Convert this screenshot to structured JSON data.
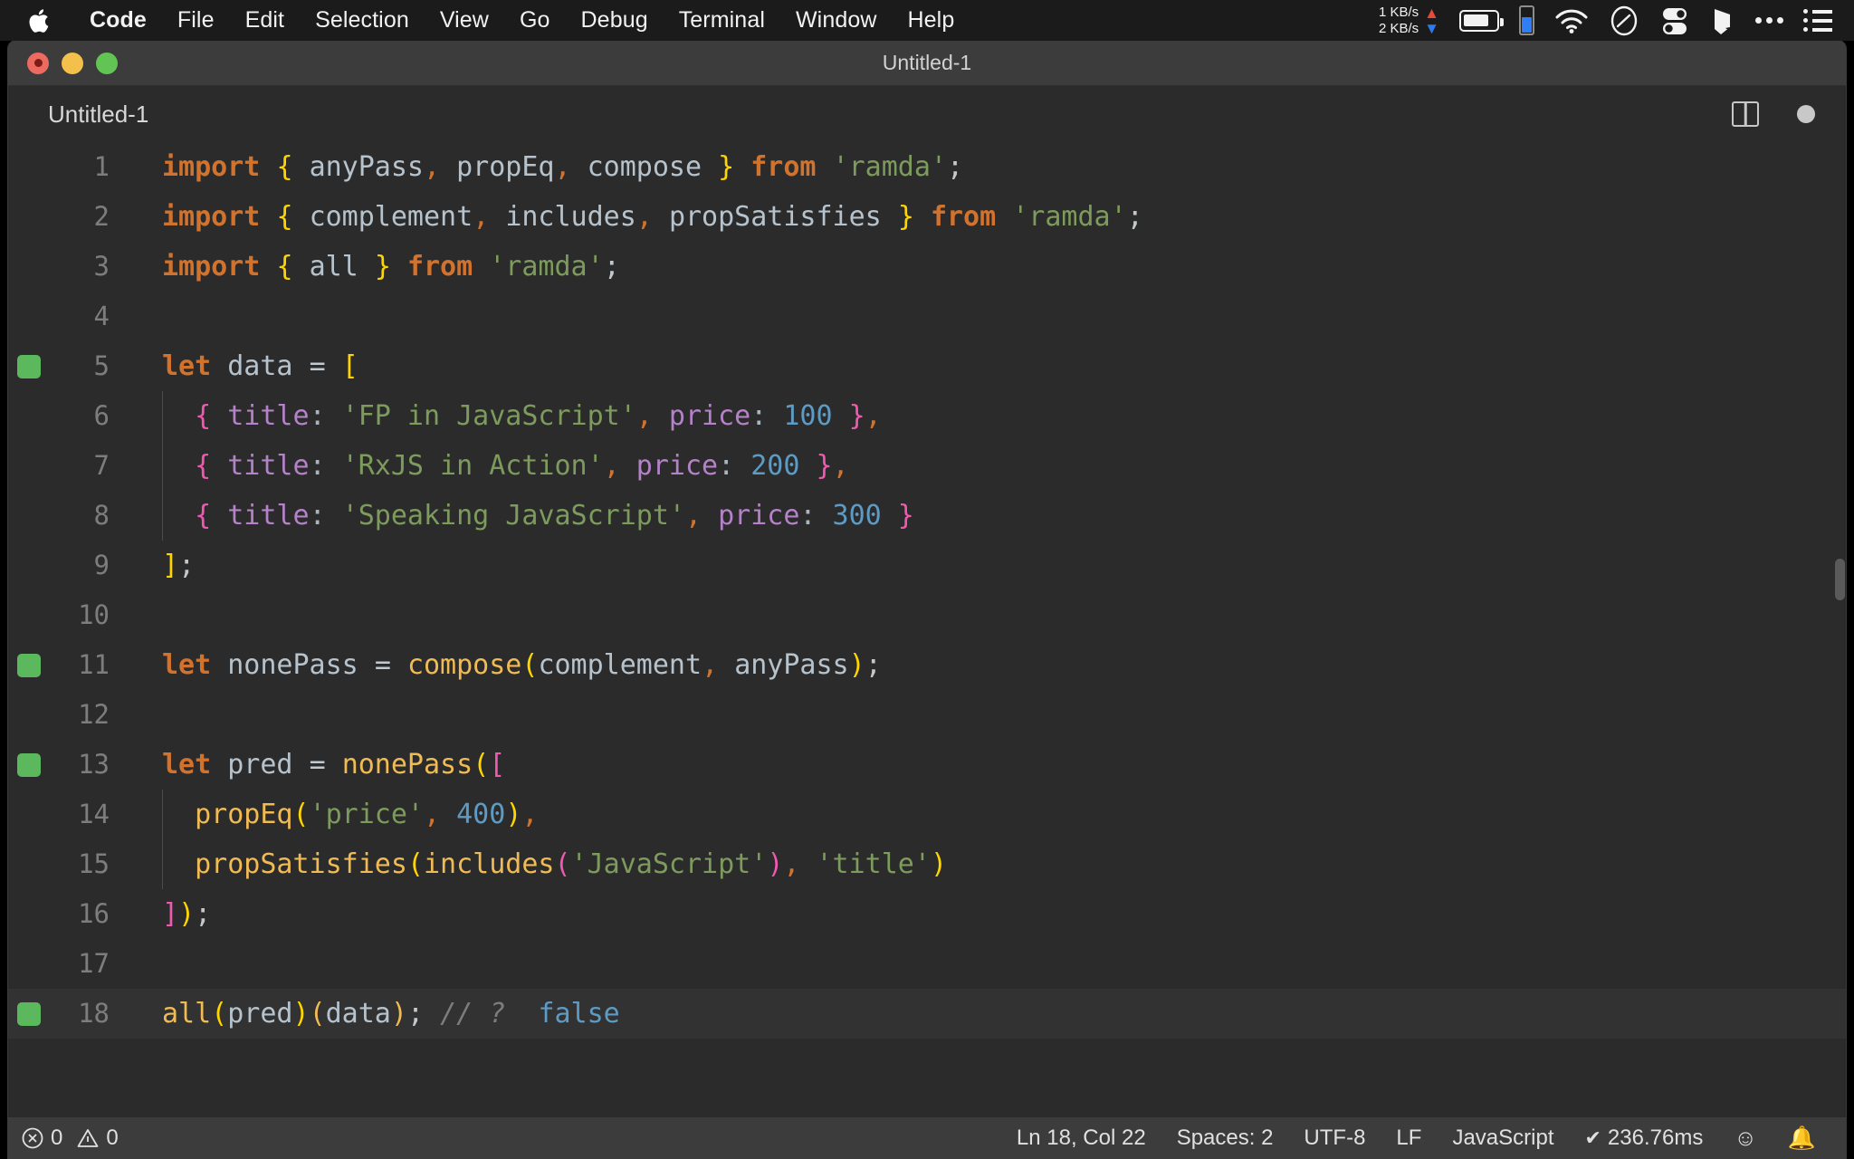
{
  "menubar": {
    "apple_icon": "apple-logo",
    "items": [
      "Code",
      "File",
      "Edit",
      "Selection",
      "View",
      "Go",
      "Debug",
      "Terminal",
      "Window",
      "Help"
    ],
    "status": {
      "net_up": "1 KB/s",
      "net_down": "2 KB/s",
      "arrow_up": "▲",
      "arrow_down": "▼",
      "icons": [
        "battery-icon",
        "phone-battery-icon",
        "wifi-icon",
        "dashboard-icon",
        "toggles-icon",
        "shape-icon",
        "ellipsis-icon",
        "list-icon"
      ]
    }
  },
  "window": {
    "title": "Untitled-1",
    "traffic_lights": [
      "close",
      "minimize",
      "maximize"
    ]
  },
  "tabbar": {
    "tab_label": "Untitled-1",
    "split_editor_icon": "split-editor-icon",
    "unsaved_indicator": "unsaved-dot-icon"
  },
  "editor": {
    "language": "JavaScript",
    "current_line": 18,
    "lines": [
      {
        "n": "1",
        "marker": false,
        "indent": 0,
        "current": false,
        "tokens": [
          {
            "t": "import",
            "c": "kw"
          },
          {
            "t": " ",
            "c": "punc"
          },
          {
            "t": "{",
            "c": "cbr"
          },
          {
            "t": " ",
            "c": "punc"
          },
          {
            "t": "anyPass",
            "c": "id"
          },
          {
            "t": ",",
            "c": "comma"
          },
          {
            "t": " ",
            "c": "punc"
          },
          {
            "t": "propEq",
            "c": "id"
          },
          {
            "t": ",",
            "c": "comma"
          },
          {
            "t": " ",
            "c": "punc"
          },
          {
            "t": "compose",
            "c": "id"
          },
          {
            "t": " ",
            "c": "punc"
          },
          {
            "t": "}",
            "c": "cbr"
          },
          {
            "t": " ",
            "c": "punc"
          },
          {
            "t": "from",
            "c": "kw"
          },
          {
            "t": " ",
            "c": "punc"
          },
          {
            "t": "'ramda'",
            "c": "str"
          },
          {
            "t": ";",
            "c": "punc"
          }
        ]
      },
      {
        "n": "2",
        "marker": false,
        "indent": 0,
        "current": false,
        "tokens": [
          {
            "t": "import",
            "c": "kw"
          },
          {
            "t": " ",
            "c": "punc"
          },
          {
            "t": "{",
            "c": "cbr"
          },
          {
            "t": " ",
            "c": "punc"
          },
          {
            "t": "complement",
            "c": "id"
          },
          {
            "t": ",",
            "c": "comma"
          },
          {
            "t": " ",
            "c": "punc"
          },
          {
            "t": "includes",
            "c": "id"
          },
          {
            "t": ",",
            "c": "comma"
          },
          {
            "t": " ",
            "c": "punc"
          },
          {
            "t": "propSatisfies",
            "c": "id"
          },
          {
            "t": " ",
            "c": "punc"
          },
          {
            "t": "}",
            "c": "cbr"
          },
          {
            "t": " ",
            "c": "punc"
          },
          {
            "t": "from",
            "c": "kw"
          },
          {
            "t": " ",
            "c": "punc"
          },
          {
            "t": "'ramda'",
            "c": "str"
          },
          {
            "t": ";",
            "c": "punc"
          }
        ]
      },
      {
        "n": "3",
        "marker": false,
        "indent": 0,
        "current": false,
        "tokens": [
          {
            "t": "import",
            "c": "kw"
          },
          {
            "t": " ",
            "c": "punc"
          },
          {
            "t": "{",
            "c": "cbr"
          },
          {
            "t": " ",
            "c": "punc"
          },
          {
            "t": "all",
            "c": "id"
          },
          {
            "t": " ",
            "c": "punc"
          },
          {
            "t": "}",
            "c": "cbr"
          },
          {
            "t": " ",
            "c": "punc"
          },
          {
            "t": "from",
            "c": "kw"
          },
          {
            "t": " ",
            "c": "punc"
          },
          {
            "t": "'ramda'",
            "c": "str"
          },
          {
            "t": ";",
            "c": "punc"
          }
        ]
      },
      {
        "n": "4",
        "marker": false,
        "indent": 0,
        "current": false,
        "tokens": []
      },
      {
        "n": "5",
        "marker": true,
        "indent": 0,
        "current": false,
        "tokens": [
          {
            "t": "let",
            "c": "kw"
          },
          {
            "t": " ",
            "c": "punc"
          },
          {
            "t": "data",
            "c": "id"
          },
          {
            "t": " ",
            "c": "punc"
          },
          {
            "t": "=",
            "c": "punc"
          },
          {
            "t": " ",
            "c": "punc"
          },
          {
            "t": "[",
            "c": "cbr"
          }
        ]
      },
      {
        "n": "6",
        "marker": false,
        "indent": 1,
        "current": false,
        "tokens": [
          {
            "t": "  ",
            "c": "punc"
          },
          {
            "t": "{",
            "c": "pbr"
          },
          {
            "t": " ",
            "c": "punc"
          },
          {
            "t": "title",
            "c": "prop"
          },
          {
            "t": ":",
            "c": "colon"
          },
          {
            "t": " ",
            "c": "punc"
          },
          {
            "t": "'FP in JavaScript'",
            "c": "str"
          },
          {
            "t": ",",
            "c": "comma"
          },
          {
            "t": " ",
            "c": "punc"
          },
          {
            "t": "price",
            "c": "prop"
          },
          {
            "t": ":",
            "c": "colon"
          },
          {
            "t": " ",
            "c": "punc"
          },
          {
            "t": "100",
            "c": "num"
          },
          {
            "t": " ",
            "c": "punc"
          },
          {
            "t": "}",
            "c": "pbr"
          },
          {
            "t": ",",
            "c": "comma"
          }
        ]
      },
      {
        "n": "7",
        "marker": false,
        "indent": 1,
        "current": false,
        "tokens": [
          {
            "t": "  ",
            "c": "punc"
          },
          {
            "t": "{",
            "c": "pbr"
          },
          {
            "t": " ",
            "c": "punc"
          },
          {
            "t": "title",
            "c": "prop"
          },
          {
            "t": ":",
            "c": "colon"
          },
          {
            "t": " ",
            "c": "punc"
          },
          {
            "t": "'RxJS in Action'",
            "c": "str"
          },
          {
            "t": ",",
            "c": "comma"
          },
          {
            "t": " ",
            "c": "punc"
          },
          {
            "t": "price",
            "c": "prop"
          },
          {
            "t": ":",
            "c": "colon"
          },
          {
            "t": " ",
            "c": "punc"
          },
          {
            "t": "200",
            "c": "num"
          },
          {
            "t": " ",
            "c": "punc"
          },
          {
            "t": "}",
            "c": "pbr"
          },
          {
            "t": ",",
            "c": "comma"
          }
        ]
      },
      {
        "n": "8",
        "marker": false,
        "indent": 1,
        "current": false,
        "tokens": [
          {
            "t": "  ",
            "c": "punc"
          },
          {
            "t": "{",
            "c": "pbr"
          },
          {
            "t": " ",
            "c": "punc"
          },
          {
            "t": "title",
            "c": "prop"
          },
          {
            "t": ":",
            "c": "colon"
          },
          {
            "t": " ",
            "c": "punc"
          },
          {
            "t": "'Speaking JavaScript'",
            "c": "str"
          },
          {
            "t": ",",
            "c": "comma"
          },
          {
            "t": " ",
            "c": "punc"
          },
          {
            "t": "price",
            "c": "prop"
          },
          {
            "t": ":",
            "c": "colon"
          },
          {
            "t": " ",
            "c": "punc"
          },
          {
            "t": "300",
            "c": "num"
          },
          {
            "t": " ",
            "c": "punc"
          },
          {
            "t": "}",
            "c": "pbr"
          }
        ]
      },
      {
        "n": "9",
        "marker": false,
        "indent": 0,
        "current": false,
        "tokens": [
          {
            "t": "]",
            "c": "cbr"
          },
          {
            "t": ";",
            "c": "punc"
          }
        ]
      },
      {
        "n": "10",
        "marker": false,
        "indent": 0,
        "current": false,
        "tokens": []
      },
      {
        "n": "11",
        "marker": true,
        "indent": 0,
        "current": false,
        "tokens": [
          {
            "t": "let",
            "c": "kw"
          },
          {
            "t": " ",
            "c": "punc"
          },
          {
            "t": "nonePass",
            "c": "id"
          },
          {
            "t": " ",
            "c": "punc"
          },
          {
            "t": "=",
            "c": "punc"
          },
          {
            "t": " ",
            "c": "punc"
          },
          {
            "t": "compose",
            "c": "fn"
          },
          {
            "t": "(",
            "c": "cbr"
          },
          {
            "t": "complement",
            "c": "id"
          },
          {
            "t": ",",
            "c": "comma"
          },
          {
            "t": " ",
            "c": "punc"
          },
          {
            "t": "anyPass",
            "c": "id"
          },
          {
            "t": ")",
            "c": "cbr"
          },
          {
            "t": ";",
            "c": "punc"
          }
        ]
      },
      {
        "n": "12",
        "marker": false,
        "indent": 0,
        "current": false,
        "tokens": []
      },
      {
        "n": "13",
        "marker": true,
        "indent": 0,
        "current": false,
        "tokens": [
          {
            "t": "let",
            "c": "kw"
          },
          {
            "t": " ",
            "c": "punc"
          },
          {
            "t": "pred",
            "c": "id"
          },
          {
            "t": " ",
            "c": "punc"
          },
          {
            "t": "=",
            "c": "punc"
          },
          {
            "t": " ",
            "c": "punc"
          },
          {
            "t": "nonePass",
            "c": "fn"
          },
          {
            "t": "(",
            "c": "cbr"
          },
          {
            "t": "[",
            "c": "pbr"
          }
        ]
      },
      {
        "n": "14",
        "marker": false,
        "indent": 1,
        "current": false,
        "tokens": [
          {
            "t": "  ",
            "c": "punc"
          },
          {
            "t": "propEq",
            "c": "fn"
          },
          {
            "t": "(",
            "c": "cbr"
          },
          {
            "t": "'price'",
            "c": "str"
          },
          {
            "t": ",",
            "c": "comma"
          },
          {
            "t": " ",
            "c": "punc"
          },
          {
            "t": "400",
            "c": "num"
          },
          {
            "t": ")",
            "c": "cbr"
          },
          {
            "t": ",",
            "c": "comma"
          }
        ]
      },
      {
        "n": "15",
        "marker": false,
        "indent": 1,
        "current": false,
        "tokens": [
          {
            "t": "  ",
            "c": "punc"
          },
          {
            "t": "propSatisfies",
            "c": "fn"
          },
          {
            "t": "(",
            "c": "cbr"
          },
          {
            "t": "includes",
            "c": "fn"
          },
          {
            "t": "(",
            "c": "pbr"
          },
          {
            "t": "'JavaScript'",
            "c": "str"
          },
          {
            "t": ")",
            "c": "pbr"
          },
          {
            "t": ",",
            "c": "comma"
          },
          {
            "t": " ",
            "c": "punc"
          },
          {
            "t": "'title'",
            "c": "str"
          },
          {
            "t": ")",
            "c": "cbr"
          }
        ]
      },
      {
        "n": "16",
        "marker": false,
        "indent": 0,
        "current": false,
        "tokens": [
          {
            "t": "]",
            "c": "pbr"
          },
          {
            "t": ")",
            "c": "cbr"
          },
          {
            "t": ";",
            "c": "punc"
          }
        ]
      },
      {
        "n": "17",
        "marker": false,
        "indent": 0,
        "current": false,
        "tokens": []
      },
      {
        "n": "18",
        "marker": true,
        "indent": 0,
        "current": true,
        "tokens": [
          {
            "t": "all",
            "c": "fn"
          },
          {
            "t": "(",
            "c": "cbr"
          },
          {
            "t": "pred",
            "c": "id"
          },
          {
            "t": ")",
            "c": "cbr"
          },
          {
            "t": "(",
            "c": "fn"
          },
          {
            "t": "data",
            "c": "id"
          },
          {
            "t": ")",
            "c": "fn"
          },
          {
            "t": ";",
            "c": "punc"
          },
          {
            "t": " ",
            "c": "punc"
          },
          {
            "t": "// ?",
            "c": "com"
          },
          {
            "t": "  ",
            "c": "punc"
          },
          {
            "t": "false",
            "c": "bool"
          }
        ]
      }
    ]
  },
  "statusbar": {
    "errors": "0",
    "warnings": "0",
    "error_icon": "error-circle-icon",
    "warning_icon": "warning-triangle-icon",
    "cursor_position": "Ln 18, Col 22",
    "spaces": "Spaces: 2",
    "encoding": "UTF-8",
    "eol": "LF",
    "language": "JavaScript",
    "run_time": "236.76ms",
    "run_check_icon": "check-icon",
    "feedback_icon": "smiley-icon",
    "notifications_icon": "bell-icon"
  },
  "colors": {
    "editor_bg": "#2b2b2b",
    "titlebar_bg": "#3c3c3c",
    "statusbar_bg": "#3c3c3c",
    "keyword": "#d2732d",
    "string": "#7d9b5c",
    "number": "#5e9bc4",
    "property": "#b482c8",
    "function": "#f0bb55",
    "bracket_yellow": "#ffd500",
    "bracket_pink": "#ef5ab0",
    "comment": "#7d7d7d",
    "run_marker_green": "#5cb85c"
  }
}
